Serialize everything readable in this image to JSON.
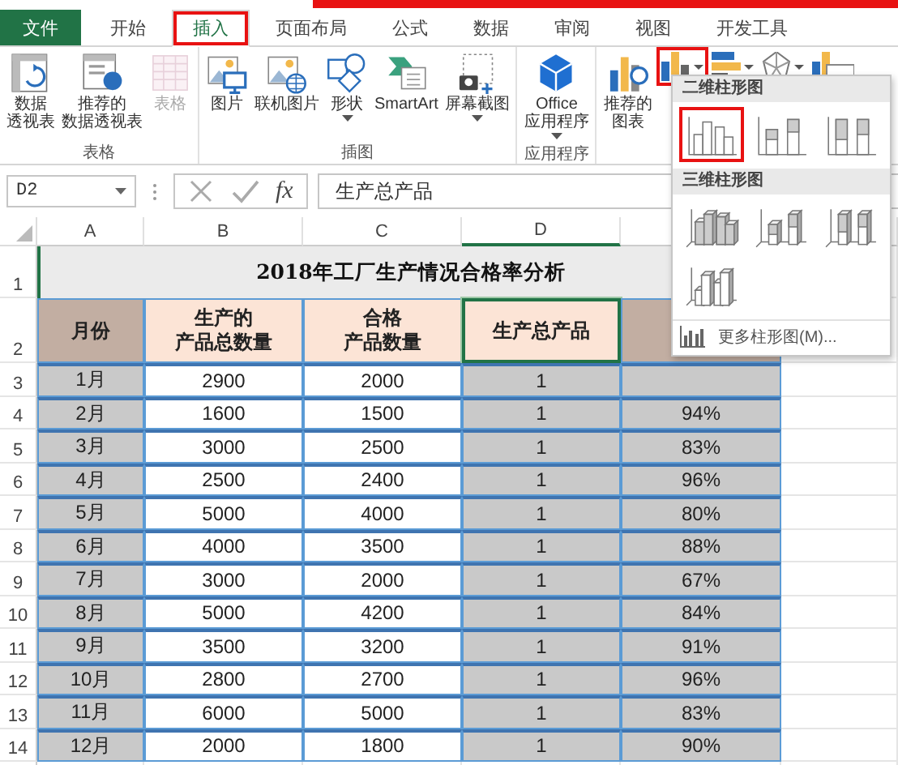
{
  "ribbon_tabs": [
    {
      "label": "文件",
      "kind": "file",
      "selected": false,
      "highlighted": false
    },
    {
      "label": "开始",
      "kind": "tab",
      "selected": false,
      "highlighted": false
    },
    {
      "label": "插入",
      "kind": "tab",
      "selected": true,
      "highlighted": true
    },
    {
      "label": "页面布局",
      "kind": "tab",
      "selected": false,
      "highlighted": false
    },
    {
      "label": "公式",
      "kind": "tab",
      "selected": false,
      "highlighted": false
    },
    {
      "label": "数据",
      "kind": "tab",
      "selected": false,
      "highlighted": false
    },
    {
      "label": "审阅",
      "kind": "tab",
      "selected": false,
      "highlighted": false
    },
    {
      "label": "视图",
      "kind": "tab",
      "selected": false,
      "highlighted": false
    },
    {
      "label": "开发工具",
      "kind": "tab",
      "selected": false,
      "highlighted": false
    }
  ],
  "ribbon_groups": [
    {
      "label": "表格",
      "buttons": [
        {
          "lines": [
            "数据",
            "透视表"
          ],
          "disabled": false,
          "dropdown": false
        },
        {
          "lines": [
            "推荐的",
            "数据透视表"
          ],
          "disabled": false,
          "dropdown": false
        },
        {
          "lines": [
            "表格"
          ],
          "disabled": true,
          "dropdown": false
        }
      ]
    },
    {
      "label": "插图",
      "buttons": [
        {
          "lines": [
            "图片"
          ],
          "disabled": false,
          "dropdown": false
        },
        {
          "lines": [
            "联机图片"
          ],
          "disabled": false,
          "dropdown": false
        },
        {
          "lines": [
            "形状"
          ],
          "disabled": false,
          "dropdown": true
        },
        {
          "lines": [
            "SmartArt"
          ],
          "disabled": false,
          "dropdown": false
        },
        {
          "lines": [
            "屏幕截图"
          ],
          "disabled": false,
          "dropdown": true
        }
      ]
    },
    {
      "label": "应用程序",
      "buttons": [
        {
          "lines": [
            "Office",
            "应用程序"
          ],
          "disabled": false,
          "dropdown": true
        }
      ]
    }
  ],
  "chart_buttons": [
    {
      "lines": [
        "推荐的",
        "图表"
      ]
    }
  ],
  "chart_type_buttons": [
    {
      "kind": "column",
      "highlighted": true
    },
    {
      "kind": "bar",
      "highlighted": false
    },
    {
      "kind": "radar",
      "highlighted": false
    },
    {
      "kind": "combo",
      "highlighted": false
    }
  ],
  "formula_bar": {
    "name_box": "D2",
    "function_label": "fx",
    "formula": "生产总产品"
  },
  "sheet": {
    "columns": [
      "A",
      "B",
      "C",
      "D"
    ],
    "title_row": "1",
    "title": "2018年工厂生产情况合格率分析",
    "header_row": "2",
    "headers": [
      {
        "lines": [
          "月份"
        ]
      },
      {
        "lines": [
          "生产的",
          "产品总数量"
        ]
      },
      {
        "lines": [
          "合格",
          "产品数量"
        ]
      },
      {
        "lines": [
          "生产总产品"
        ]
      }
    ],
    "rows": [
      {
        "row": "3",
        "month": "1月",
        "total": "2900",
        "qualified": "2000",
        "product": "1"
      },
      {
        "row": "4",
        "month": "2月",
        "total": "1600",
        "qualified": "1500",
        "product": "1",
        "rate": "94%"
      },
      {
        "row": "5",
        "month": "3月",
        "total": "3000",
        "qualified": "2500",
        "product": "1",
        "rate": "83%"
      },
      {
        "row": "6",
        "month": "4月",
        "total": "2500",
        "qualified": "2400",
        "product": "1",
        "rate": "96%"
      },
      {
        "row": "7",
        "month": "5月",
        "total": "5000",
        "qualified": "4000",
        "product": "1",
        "rate": "80%"
      },
      {
        "row": "8",
        "month": "6月",
        "total": "4000",
        "qualified": "3500",
        "product": "1",
        "rate": "88%"
      },
      {
        "row": "9",
        "month": "7月",
        "total": "3000",
        "qualified": "2000",
        "product": "1",
        "rate": "67%"
      },
      {
        "row": "10",
        "month": "8月",
        "total": "5000",
        "qualified": "4200",
        "product": "1",
        "rate": "84%"
      },
      {
        "row": "11",
        "month": "9月",
        "total": "3500",
        "qualified": "3200",
        "product": "1",
        "rate": "91%"
      },
      {
        "row": "12",
        "month": "10月",
        "total": "2800",
        "qualified": "2700",
        "product": "1",
        "rate": "96%"
      },
      {
        "row": "13",
        "month": "11月",
        "total": "6000",
        "qualified": "5000",
        "product": "1",
        "rate": "83%"
      },
      {
        "row": "14",
        "month": "12月",
        "total": "2000",
        "qualified": "1800",
        "product": "1",
        "rate": "90%"
      }
    ]
  },
  "chart_dropdown": {
    "sections": [
      {
        "title": "二维柱形图",
        "items": [
          {
            "kind": "clustered",
            "highlighted": true
          },
          {
            "kind": "stacked",
            "highlighted": false
          },
          {
            "kind": "percent",
            "highlighted": false
          }
        ]
      },
      {
        "title": "三维柱形图",
        "items": [
          {
            "kind": "clustered3d",
            "highlighted": false
          },
          {
            "kind": "stacked3d",
            "highlighted": false
          },
          {
            "kind": "percent3d",
            "highlighted": false
          },
          {
            "kind": "column3d",
            "highlighted": false
          }
        ]
      }
    ],
    "more": "更多柱形图(M)..."
  }
}
